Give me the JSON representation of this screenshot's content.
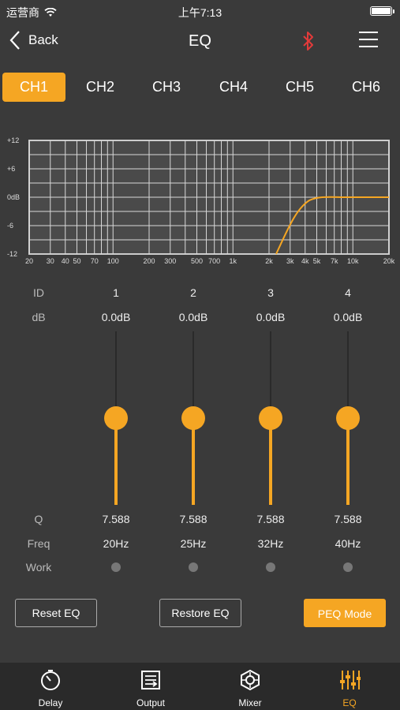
{
  "status_bar": {
    "carrier": "运营商",
    "time": "上午7:13"
  },
  "nav": {
    "back_label": "Back",
    "title": "EQ"
  },
  "colors": {
    "accent": "#f5a623",
    "background": "#3a3a3a",
    "bluetooth": "#e23a3a"
  },
  "channels": [
    "CH1",
    "CH2",
    "CH3",
    "CH4",
    "CH5",
    "CH6"
  ],
  "active_channel": "CH1",
  "graph": {
    "y_ticks": [
      "+12",
      "+6",
      "0dB",
      "-6",
      "-12"
    ],
    "x_ticks": [
      "20",
      "30",
      "40",
      "50",
      "70",
      "100",
      "200",
      "300",
      "500",
      "700",
      "1k",
      "2k",
      "3k",
      "4k",
      "5k",
      "7k",
      "10k",
      "20k"
    ]
  },
  "row_labels": {
    "id": "ID",
    "db": "dB",
    "q": "Q",
    "freq": "Freq",
    "work": "Work"
  },
  "bands": [
    {
      "id": "1",
      "db": "0.0dB",
      "q": "7.588",
      "freq": "20Hz",
      "level": 0.5
    },
    {
      "id": "2",
      "db": "0.0dB",
      "q": "7.588",
      "freq": "25Hz",
      "level": 0.5
    },
    {
      "id": "3",
      "db": "0.0dB",
      "q": "7.588",
      "freq": "32Hz",
      "level": 0.5
    },
    {
      "id": "4",
      "db": "0.0dB",
      "q": "7.588",
      "freq": "40Hz",
      "level": 0.5
    }
  ],
  "buttons": {
    "reset": "Reset EQ",
    "restore": "Restore EQ",
    "mode": "PEQ Mode"
  },
  "tabbar": [
    {
      "label": "Delay",
      "icon": "stopwatch-icon"
    },
    {
      "label": "Output",
      "icon": "output-icon"
    },
    {
      "label": "Mixer",
      "icon": "mixer-icon"
    },
    {
      "label": "EQ",
      "icon": "eq-sliders-icon"
    }
  ],
  "active_tab": "EQ"
}
